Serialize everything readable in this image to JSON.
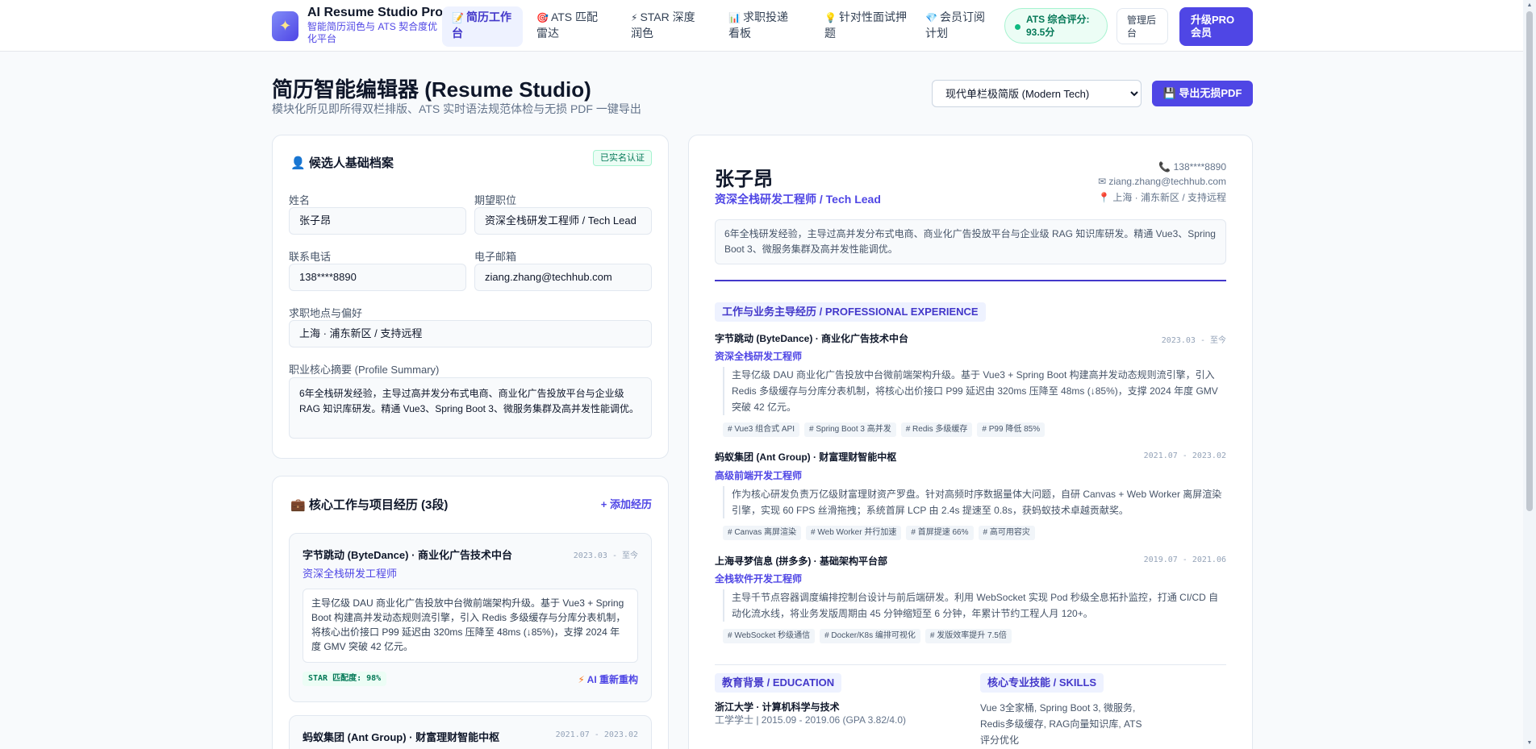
{
  "brand": {
    "title": "AI Resume Studio Pro",
    "subtitle": "智能简历润色与 ATS 契合度优化平台",
    "logo_icon": "sparkle-icon"
  },
  "nav": [
    {
      "label": "简历工作台",
      "icon": "📝",
      "active": true
    },
    {
      "label": "ATS 匹配雷达",
      "icon": "🎯",
      "active": false
    },
    {
      "label": "STAR 深度润色",
      "icon": "⚡",
      "active": false
    },
    {
      "label": "求职投递看板",
      "icon": "📊",
      "active": false
    },
    {
      "label": "针对性面试押题",
      "icon": "💡",
      "active": false
    },
    {
      "label": "会员订阅计划",
      "icon": "💎",
      "active": false
    }
  ],
  "ats_score": "ATS 综合评分: 93.5分",
  "admin_button": "管理后台",
  "pro_button": "升级PRO会员",
  "page": {
    "title": "简历智能编辑器 (Resume Studio)",
    "subtitle": "模块化所见即所得双栏排版、ATS 实时语法规范体检与无损 PDF 一键导出"
  },
  "template_select": {
    "selected": "现代单栏极简版 (Modern Tech)"
  },
  "export_button": "导出无损PDF",
  "profile_card": {
    "title": "候选人基础档案",
    "badge": "已实名认证",
    "fields": {
      "name": {
        "label": "姓名",
        "value": "张子昂"
      },
      "position": {
        "label": "期望职位",
        "value": "资深全栈研发工程师 / Tech Lead"
      },
      "phone": {
        "label": "联系电话",
        "value": "138****8890"
      },
      "email": {
        "label": "电子邮箱",
        "value": "ziang.zhang@techhub.com"
      },
      "location": {
        "label": "求职地点与偏好",
        "value": "上海 · 浦东新区 / 支持远程"
      },
      "summary": {
        "label": "职业核心摘要 (Profile Summary)",
        "value": "6年全栈研发经验，主导过高并发分布式电商、商业化广告投放平台与企业级 RAG 知识库研发。精通 Vue3、Spring Boot 3、微服务集群及高并发性能调优。"
      }
    }
  },
  "experience_card": {
    "title": "核心工作与项目经历 (3段)",
    "add_label": "+ 添加经历",
    "items": [
      {
        "company": "字节跳动 (ByteDance) · 商业化广告技术中台",
        "date": "2023.03 - 至今",
        "role": "资深全栈研发工程师",
        "desc": "主导亿级 DAU 商业化广告投放中台微前端架构升级。基于 Vue3 + Spring Boot 构建高并发动态规则流引擎，引入 Redis 多级缓存与分库分表机制，将核心出价接口 P99 延迟由 320ms 压降至 48ms (↓85%)，支撑 2024 年度 GMV 突破 42 亿元。",
        "star": "STAR 匹配度: 98%",
        "ai_label": "AI 重新重构"
      },
      {
        "company": "蚂蚁集团 (Ant Group) · 财富理财智能中枢",
        "date": "2021.07 - 2023.02"
      }
    ]
  },
  "resume": {
    "name": "张子昂",
    "title": "资深全栈研发工程师 / Tech Lead",
    "phone": "138****8890",
    "email": "ziang.zhang@techhub.com",
    "location": "上海 · 浦东新区 / 支持远程",
    "summary": "6年全栈研发经验，主导过高并发分布式电商、商业化广告投放平台与企业级 RAG 知识库研发。精通 Vue3、Spring Boot 3、微服务集群及高并发性能调优。",
    "experience_heading": "工作与业务主导经历 / PROFESSIONAL EXPERIENCE",
    "jobs": [
      {
        "company": "字节跳动 (ByteDance) · 商业化广告技术中台",
        "date": "2023.03 - 至今",
        "role": "资深全栈研发工程师",
        "desc": "主导亿级 DAU 商业化广告投放中台微前端架构升级。基于 Vue3 + Spring Boot 构建高并发动态规则流引擎，引入 Redis 多级缓存与分库分表机制，将核心出价接口 P99 延迟由 320ms 压降至 48ms (↓85%)，支撑 2024 年度 GMV 突破 42 亿元。",
        "tags": [
          "# Vue3 组合式 API",
          "# Spring Boot 3 高并发",
          "# Redis 多级缓存",
          "# P99 降低 85%"
        ]
      },
      {
        "company": "蚂蚁集团 (Ant Group) · 财富理财智能中枢",
        "date": "2021.07 - 2023.02",
        "role": "高级前端开发工程师",
        "desc": "作为核心研发负责万亿级财富理财资产罗盘。针对高频时序数据量体大问题，自研 Canvas + Web Worker 离屏渲染引擎，实现 60 FPS 丝滑拖拽；系统首屏 LCP 由 2.4s 提速至 0.8s，获蚂蚁技术卓越贡献奖。",
        "tags": [
          "# Canvas 离屏渲染",
          "# Web Worker 并行加速",
          "# 首屏提速 66%",
          "# 高可用容灾"
        ]
      },
      {
        "company": "上海寻梦信息 (拼多多) · 基础架构平台部",
        "date": "2019.07 - 2021.06",
        "role": "全栈软件开发工程师",
        "desc": "主导千节点容器调度编排控制台设计与前后端研发。利用 WebSocket 实现 Pod 秒级全息拓扑监控，打通 CI/CD 自动化流水线，将业务发版周期由 45 分钟缩短至 6 分钟，年累计节约工程人月 120+。",
        "tags": [
          "# WebSocket 秒级通信",
          "# Docker/K8s 编排可视化",
          "# 发版效率提升 7.5倍"
        ]
      }
    ],
    "education_heading": "教育背景 / EDUCATION",
    "education_school": "浙江大学 · 计算机科学与技术",
    "education_detail": "工学学士 | 2015.09 - 2019.06 (GPA 3.82/4.0)",
    "skills_heading": "核心专业技能 / SKILLS",
    "skills": "Vue 3全家桶, Spring Boot 3, 微服务, Redis多级缓存, RAG向量知识库, ATS评分优化"
  },
  "colors": {
    "accent": "#4f46e5",
    "success": "#047857",
    "background": "#f8fafc"
  }
}
